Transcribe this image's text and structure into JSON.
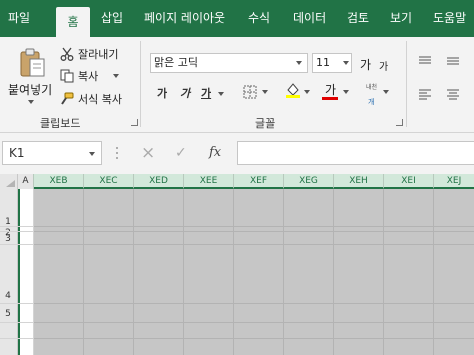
{
  "tabs": [
    "파일",
    "홈",
    "삽입",
    "페이지 레이아웃",
    "수식",
    "데이터",
    "검토",
    "보기",
    "도움말"
  ],
  "active_tab": "홈",
  "clipboard": {
    "paste_label": "붙여넣기",
    "cut_label": "잘라내기",
    "copy_label": "복사",
    "format_painter_label": "서식 복사",
    "group_label": "클립보드"
  },
  "font": {
    "name": "맑은 고딕",
    "size": "11",
    "grow_label": "가",
    "shrink_label": "가",
    "bold": "가",
    "italic": "가",
    "underline": "가",
    "font_color_label": "가",
    "phonetic_label": "내천",
    "group_label": "글꼴",
    "highlight_color": "#ffff00",
    "font_color": "#e00000"
  },
  "formula_bar": {
    "name_box": "K1",
    "cancel_icon": "×",
    "enter_icon": "✓",
    "fx_label": "fx",
    "formula": ""
  },
  "columns": [
    "A",
    "XEB",
    "XEC",
    "XED",
    "XEE",
    "XEF",
    "XEG",
    "XEH",
    "XEI",
    "XEJ"
  ],
  "rows": [
    "1",
    "2",
    "3",
    "4",
    "5"
  ],
  "colors": {
    "accent": "#217346",
    "selection_fill": "#c6c6c6",
    "header_selected": "#d2e8da"
  }
}
